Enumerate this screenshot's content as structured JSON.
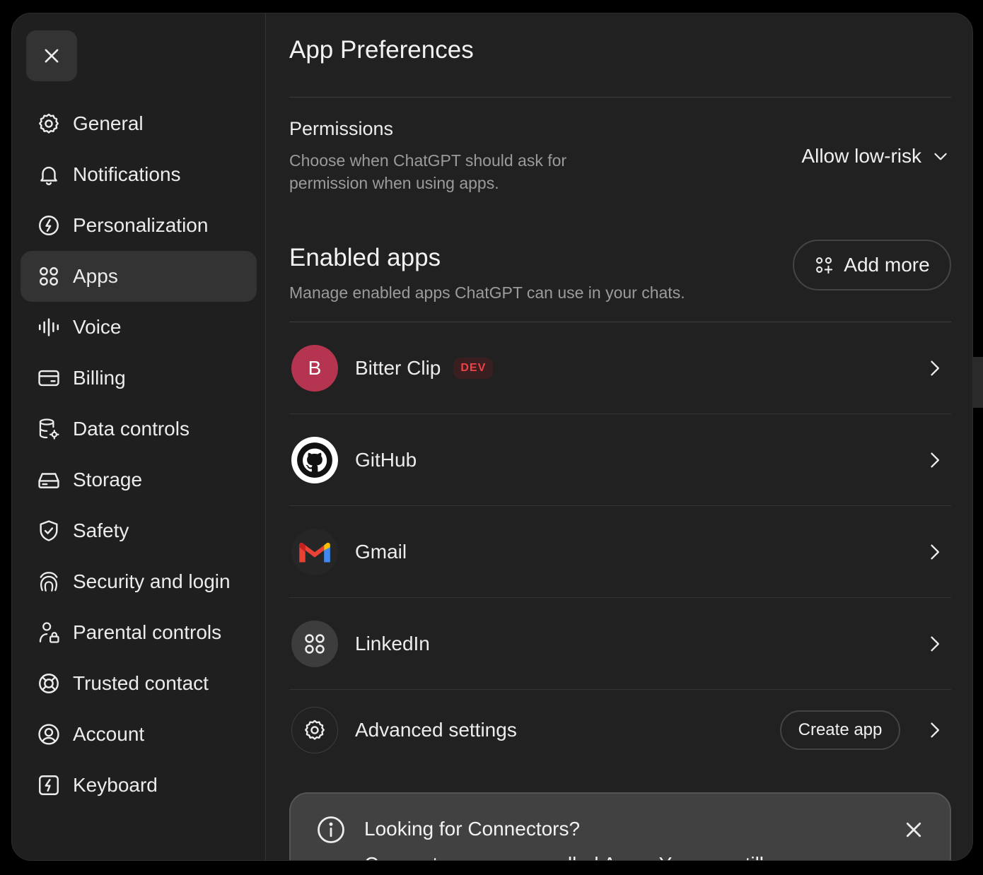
{
  "sidebar": {
    "close_icon": "close-icon",
    "items": [
      {
        "label": "General",
        "icon": "gear-icon"
      },
      {
        "label": "Notifications",
        "icon": "bell-icon"
      },
      {
        "label": "Personalization",
        "icon": "personalization-icon"
      },
      {
        "label": "Apps",
        "icon": "apps-grid-icon",
        "active": true
      },
      {
        "label": "Voice",
        "icon": "voice-waveform-icon"
      },
      {
        "label": "Billing",
        "icon": "card-icon"
      },
      {
        "label": "Data controls",
        "icon": "database-gear-icon"
      },
      {
        "label": "Storage",
        "icon": "storage-drive-icon"
      },
      {
        "label": "Safety",
        "icon": "shield-check-icon"
      },
      {
        "label": "Security and login",
        "icon": "security-fingerprint-icon"
      },
      {
        "label": "Parental controls",
        "icon": "person-lock-icon"
      },
      {
        "label": "Trusted contact",
        "icon": "lifebuoy-icon"
      },
      {
        "label": "Account",
        "icon": "user-circle-icon"
      },
      {
        "label": "Keyboard",
        "icon": "keyboard-bolt-icon"
      }
    ]
  },
  "main": {
    "title": "App Preferences",
    "permissions": {
      "title": "Permissions",
      "description": "Choose when ChatGPT should ask for permission when using apps.",
      "selected": "Allow low-risk"
    },
    "enabled_apps": {
      "title": "Enabled apps",
      "description": "Manage enabled apps ChatGPT can use in your chats.",
      "add_more_label": "Add more",
      "apps": [
        {
          "name": "Bitter Clip",
          "initial": "B",
          "badge": "DEV",
          "color": "#b5344f"
        },
        {
          "name": "GitHub",
          "icon": "github-icon"
        },
        {
          "name": "Gmail",
          "icon": "gmail-icon"
        },
        {
          "name": "LinkedIn",
          "icon": "apps-grid-icon"
        }
      ],
      "advanced": {
        "label": "Advanced settings",
        "button": "Create app"
      }
    },
    "banner": {
      "title": "Looking for Connectors?",
      "body": "Connectors are now called Apps. You can still manage"
    }
  },
  "colors": {
    "background": "#212121",
    "sidebar": "#1f1f1f",
    "active_item": "#333333",
    "muted_text": "#9b9b9b",
    "dev_badge": "#ef4146",
    "bitter_clip": "#b5344f"
  }
}
